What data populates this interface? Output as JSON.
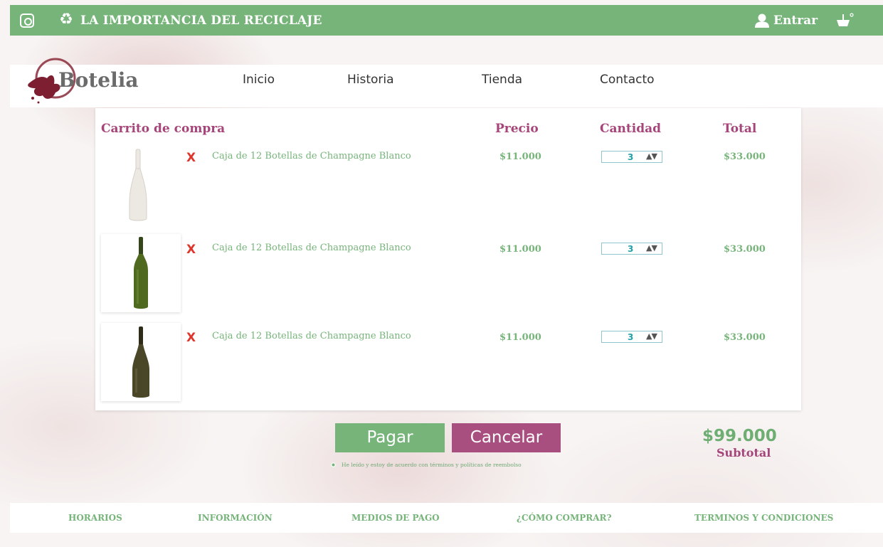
{
  "topbar": {
    "site_title": "LA IMPORTANCIA DEL RECICLAJE",
    "login_label": "Entrar",
    "icons": [
      "instagram-icon",
      "recycle-icon",
      "user-icon",
      "basket-icon"
    ]
  },
  "logo": {
    "text": "Botelia"
  },
  "nav": {
    "items": [
      "Inicio",
      "Historia",
      "Tienda",
      "Contacto"
    ]
  },
  "cart": {
    "headers": {
      "title": "Carrito de compra",
      "price": "Precio",
      "quantity": "Cantidad",
      "total": "Total"
    },
    "remove_label": "X",
    "spinner_label": "▲▼",
    "items": [
      {
        "name": "Caja de 12 Botellas de Champagne Blanco",
        "price": "$11.000",
        "quantity": "3",
        "total": "$33.000",
        "bottle_color": "#ece8e2"
      },
      {
        "name": "Caja de 12 Botellas de Champagne Blanco",
        "price": "$11.000",
        "quantity": "3",
        "total": "$33.000",
        "bottle_color": "#4f6a1e"
      },
      {
        "name": "Caja de 12 Botellas de Champagne Blanco",
        "price": "$11.000",
        "quantity": "3",
        "total": "$33.000",
        "bottle_color": "#4a4628"
      }
    ]
  },
  "actions": {
    "pay_label": "Pagar",
    "cancel_label": "Cancelar",
    "terms_text": "He leído y estoy de acuerdo con términos y políticas de reembolso"
  },
  "subtotal": {
    "amount": "$99.000",
    "label": "Subtotal"
  },
  "footer": {
    "items": [
      "HORARIOS",
      "INFORMACIÓN",
      "MEDIOS DE PAGO",
      "¿CÓMO COMPRAR?",
      "TERMINOS Y CONDICIONES"
    ]
  },
  "colors": {
    "green": "#76b47a",
    "purple": "#a5457a",
    "red": "#e0352b",
    "teal": "#23a0a8"
  }
}
